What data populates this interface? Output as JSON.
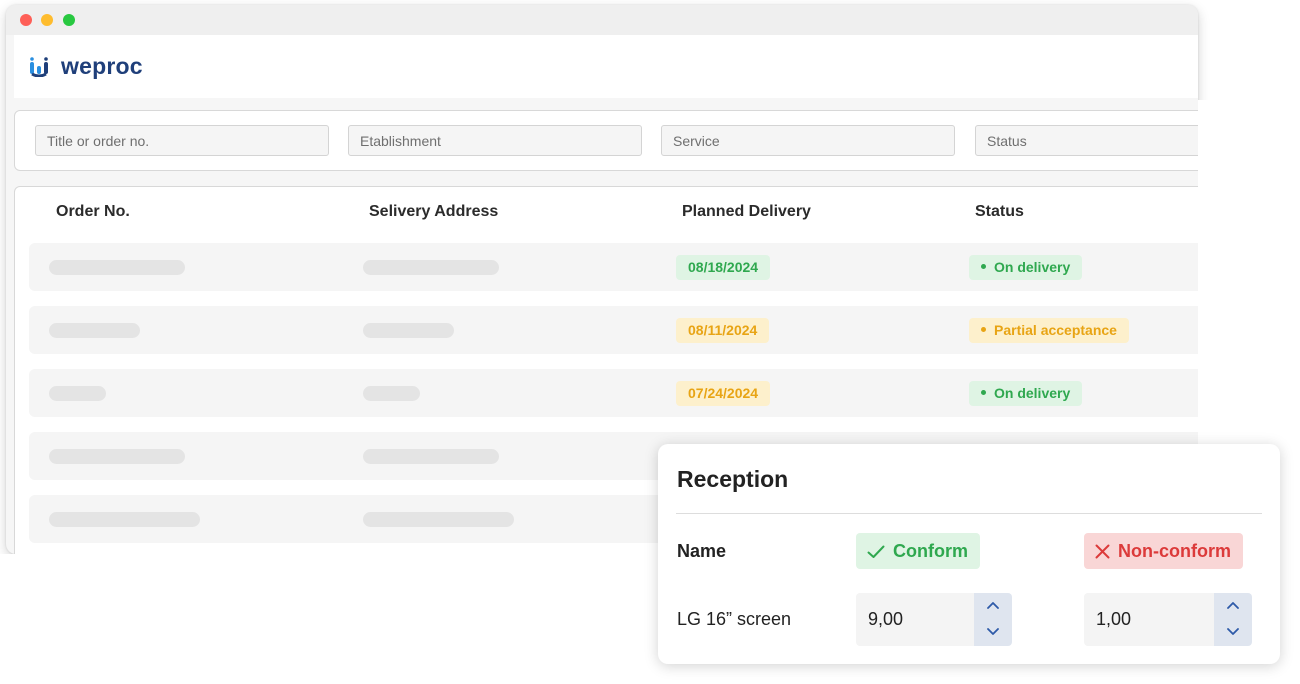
{
  "app": {
    "name": "weproc"
  },
  "filters": {
    "title_placeholder": "Title or order no.",
    "establishment_placeholder": "Etablishment",
    "service_placeholder": "Service",
    "status_placeholder": "Status"
  },
  "table": {
    "columns": [
      "Order No.",
      "Selivery Address",
      "Planned Delivery",
      "Status"
    ],
    "rows": [
      {
        "planned_delivery": "08/18/2024",
        "status": "On delivery"
      },
      {
        "planned_delivery": "08/11/2024",
        "status": "Partial acceptance"
      },
      {
        "planned_delivery": "07/24/2024",
        "status": "On delivery"
      }
    ]
  },
  "reception": {
    "title": "Reception",
    "name_label": "Name",
    "conform_label": "Conform",
    "nonconform_label": "Non-conform",
    "item": {
      "name": "LG 16” screen",
      "conform_qty": "9,00",
      "nonconform_qty": "1,00"
    }
  },
  "colors": {
    "brand": "#1f3f7a",
    "status_green": "#2fa84f",
    "status_yellow": "#e8a414",
    "status_red": "#dc3a3a"
  }
}
